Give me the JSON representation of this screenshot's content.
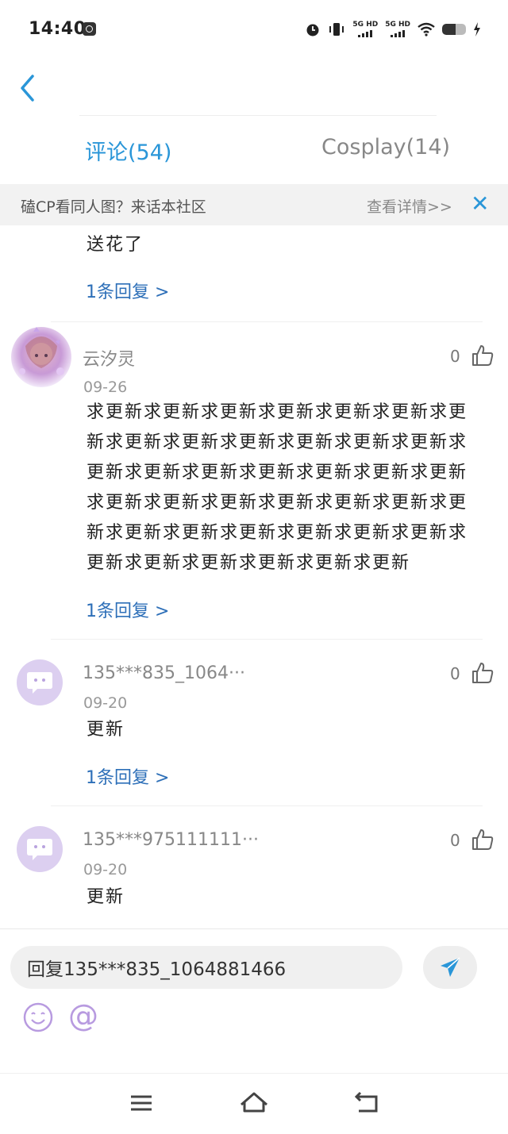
{
  "status_bar": {
    "time": "14:40",
    "network_1": "5G HD",
    "network_2": "5G HD"
  },
  "tabs": [
    {
      "label": "评论(54)",
      "active": true
    },
    {
      "label": "Cosplay(14)",
      "active": false
    }
  ],
  "banner": {
    "text": "磕CP看同人图？来话本社区",
    "link": "查看详情>>",
    "close": "✕"
  },
  "comments": [
    {
      "body": "送花了",
      "replies": "1条回复 >"
    },
    {
      "username": "云汐灵",
      "date": "09-26",
      "likes": "0",
      "body": "求更新求更新求更新求更新求更新求更新求更新求更新求更新求更新求更新求更新求更新求更新求更新求更新求更新求更新求更新求更新求更新求更新求更新求更新求更新求更新求更新求更新求更新求更新求更新求更新求更新求更新求更新求更新求更新求更新求更新",
      "replies": "1条回复 >"
    },
    {
      "username": "135***835_1064···",
      "date": "09-20",
      "likes": "0",
      "body": "更新",
      "replies": "1条回复 >"
    },
    {
      "username": "135***975111111···",
      "date": "09-20",
      "likes": "0",
      "body": "更新"
    }
  ],
  "reply_box": {
    "value": "回复135***835_1064881466",
    "at_symbol": "@"
  },
  "colors": {
    "accent": "#2a96d8",
    "reply_link": "#2d6fb8",
    "avatar_bg": "#dccff0"
  },
  "icons": [
    "back-icon",
    "like-icon",
    "send-icon",
    "emoji-icon",
    "menu-icon",
    "home-icon",
    "back-nav-icon"
  ]
}
